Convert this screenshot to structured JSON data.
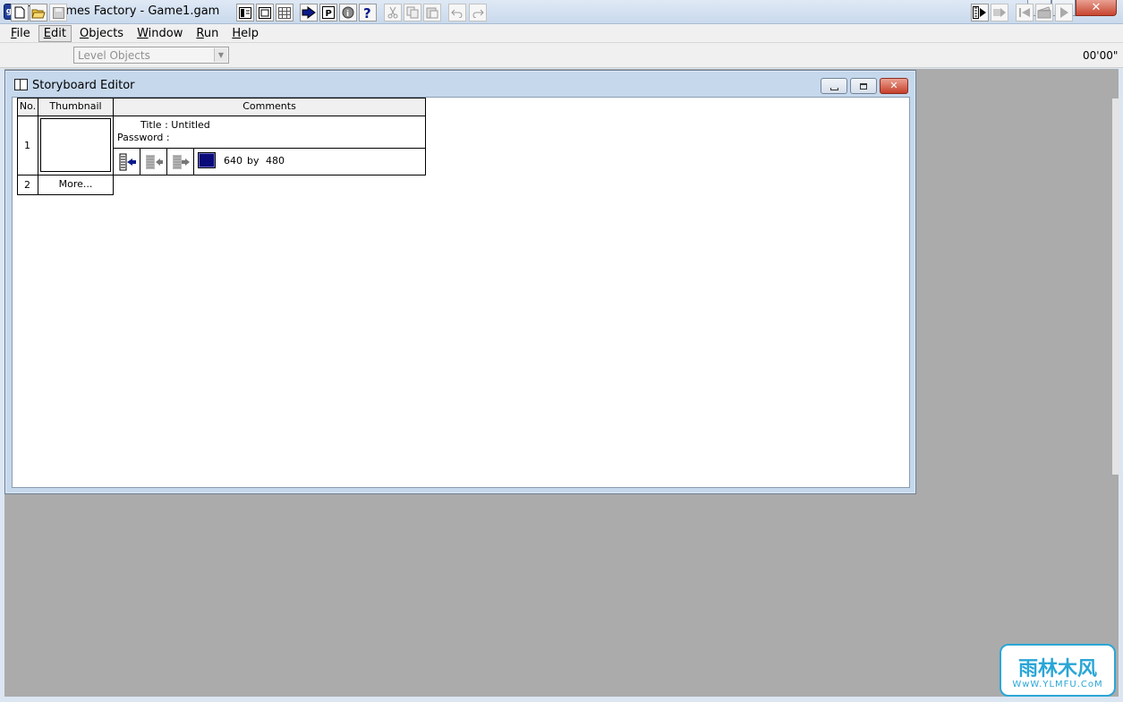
{
  "window": {
    "title": "The Games Factory - Game1.gam",
    "icon_text": "gF"
  },
  "menu": [
    {
      "mn": "F",
      "rest": "ile"
    },
    {
      "mn": "E",
      "rest": "dit"
    },
    {
      "mn": "O",
      "rest": "bjects"
    },
    {
      "mn": "W",
      "rest": "indow"
    },
    {
      "mn": "R",
      "rest": "un"
    },
    {
      "mn": "H",
      "rest": "elp"
    }
  ],
  "toolbar": {
    "level_select_value": "Level Objects",
    "timer": "00'00\""
  },
  "storyboard": {
    "title": "Storyboard Editor",
    "headers": {
      "no": "No.",
      "thumbnail": "Thumbnail",
      "comments": "Comments"
    },
    "rows": [
      {
        "no": "1",
        "title": "Title : Untitled",
        "password": "Password :",
        "width": "640",
        "by": "by",
        "height": "480",
        "bg_color": "#0a0a78"
      },
      {
        "no": "2",
        "more": "More..."
      }
    ]
  },
  "icons": {
    "new": "new-file-icon",
    "open": "open-folder-icon",
    "save": "save-icon",
    "storyboard": "storyboard-view-icon",
    "level": "level-editor-icon",
    "event": "event-editor-icon",
    "cut": "cut-icon",
    "copy": "copy-icon",
    "paste": "paste-icon",
    "undo": "undo-icon",
    "redo": "redo-icon"
  },
  "watermark": {
    "main": "雨林木风",
    "sub": "WwW.YLMFU.CoM"
  }
}
